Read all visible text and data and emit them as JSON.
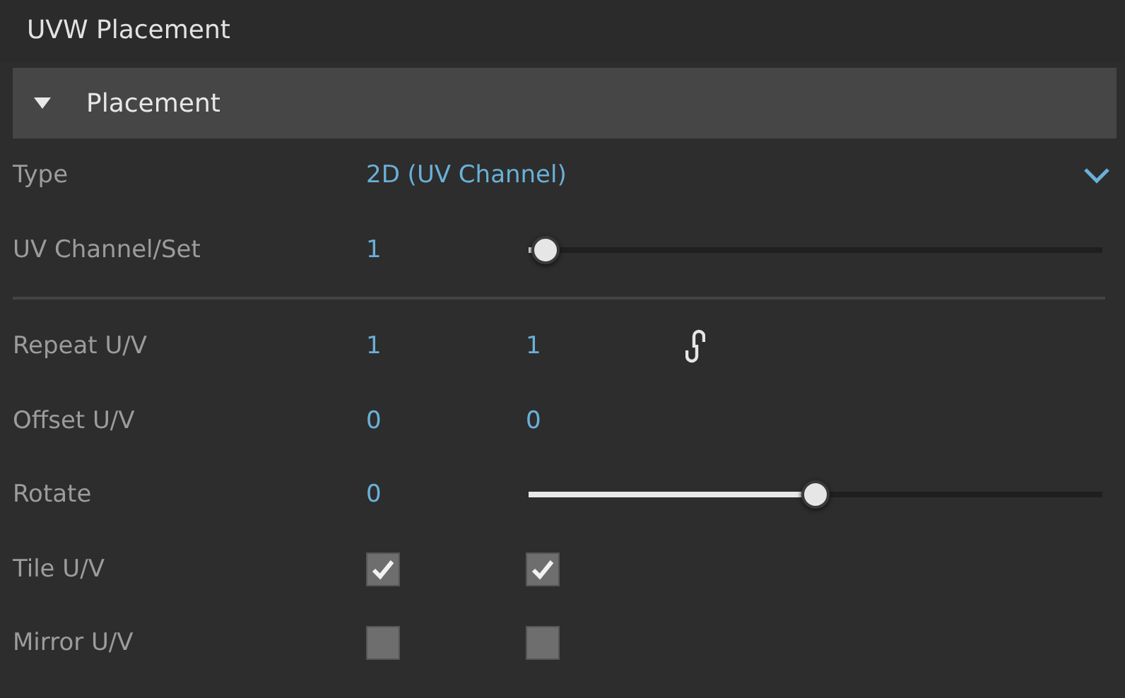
{
  "panel": {
    "title": "UVW Placement"
  },
  "section": {
    "label": "Placement",
    "expanded": true
  },
  "rows": [
    {
      "kind": "dropdown",
      "label": "Type",
      "value": "2D (UV Channel)"
    },
    {
      "kind": "slider",
      "label": "UV Channel/Set",
      "value": "1",
      "level": 0.03
    },
    {
      "kind": "divider"
    },
    {
      "kind": "pair",
      "label": "Repeat U/V",
      "values": [
        "1",
        "1"
      ],
      "linked": true
    },
    {
      "kind": "pair",
      "label": "Offset U/V",
      "values": [
        "0",
        "0"
      ]
    },
    {
      "kind": "slider",
      "label": "Rotate",
      "value": "0",
      "level": 0.5
    },
    {
      "kind": "checks",
      "label": "Tile U/V",
      "checks": [
        {
          "checked": true
        },
        {
          "checked": true
        }
      ]
    },
    {
      "kind": "checks",
      "label": "Mirror U/V",
      "checks": [
        {
          "checked": false
        },
        {
          "checked": false
        }
      ]
    }
  ]
}
